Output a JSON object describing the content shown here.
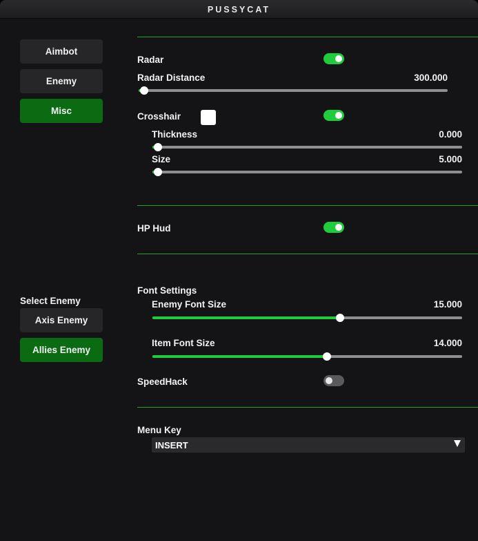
{
  "window": {
    "title": "PUSSYCAT"
  },
  "sidebar": {
    "tabs": [
      {
        "label": "Aimbot",
        "active": false
      },
      {
        "label": "Enemy",
        "active": false
      },
      {
        "label": "Misc",
        "active": true
      }
    ],
    "select_enemy_label": "Select Enemy",
    "enemy_buttons": [
      {
        "label": "Axis Enemy",
        "active": false
      },
      {
        "label": "Allies Enemy",
        "active": true
      }
    ]
  },
  "radar": {
    "label": "Radar",
    "enabled": true,
    "distance_label": "Radar Distance",
    "distance_value": "300.000",
    "distance_fraction": 0.0
  },
  "crosshair": {
    "label": "Crosshair",
    "enabled": true,
    "color": "#ffffff",
    "thickness_label": "Thickness",
    "thickness_value": "0.000",
    "thickness_fraction": 0.0,
    "size_label": "Size",
    "size_value": "5.000",
    "size_fraction": 0.0
  },
  "hp_hud": {
    "label": "HP Hud",
    "enabled": true
  },
  "font_settings": {
    "label": "Font Settings",
    "enemy_font_label": "Enemy Font Size",
    "enemy_font_value": "15.000",
    "enemy_font_fraction": 0.61,
    "item_font_label": "Item Font Size",
    "item_font_value": "14.000",
    "item_font_fraction": 0.565
  },
  "speedhack": {
    "label": "SpeedHack",
    "enabled": false
  },
  "menu_key": {
    "label": "Menu Key",
    "value": "INSERT"
  },
  "colors": {
    "accent": "#1fcc3c",
    "active_button": "#0a6b12",
    "separator": "#1fa32f"
  }
}
